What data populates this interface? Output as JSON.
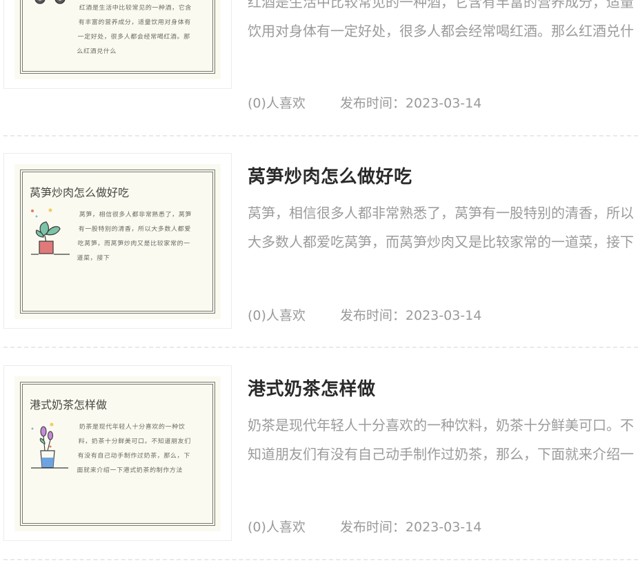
{
  "articles": [
    {
      "title": "",
      "thumb_title": "",
      "thumb_text": "红酒是生活中比较常见的一种酒，它含有丰富的营养成分，适量饮用对身体有一定好处，很多人都会经常喝红酒。那么红酒兑什么",
      "desc": "红酒是生活中比较常见的一种酒，它含有丰富的营养成分，适量饮用对身体有一定好处，很多人都会经常喝红酒。那么红酒兑什么",
      "likes": "(0)人喜欢",
      "time": "发布时间：2023-03-14",
      "icon": "jeep-icon"
    },
    {
      "title": "莴笋炒肉怎么做好吃",
      "thumb_title": "莴笋炒肉怎么做好吃",
      "thumb_text": "莴笋，相信很多人都非常熟悉了，莴笋有一股特别的清香，所以大多数人都爱吃莴笋，而莴笋炒肉又是比较家常的一道菜，接下",
      "desc": "莴笋，相信很多人都非常熟悉了，莴笋有一股特别的清香，所以大多数人都爱吃莴笋，而莴笋炒肉又是比较家常的一道菜，接下",
      "likes": "(0)人喜欢",
      "time": "发布时间：2023-03-14",
      "icon": "potted-plant-icon"
    },
    {
      "title": "港式奶茶怎样做",
      "thumb_title": "港式奶茶怎样做",
      "thumb_text": "奶茶是现代年轻人十分喜欢的一种饮料，奶茶十分鲜美可口。不知道朋友们有没有自己动手制作过奶茶，那么，下面就来介绍一下港式奶茶的制作方法",
      "desc": "奶茶是现代年轻人十分喜欢的一种饮料，奶茶十分鲜美可口。不知道朋友们有没有自己动手制作过奶茶，那么，下面就来介绍一下港式奶茶的制作方法",
      "likes": "(0)人喜欢",
      "time": "发布时间：2023-03-14",
      "icon": "flower-vase-icon"
    }
  ],
  "colors": {
    "title": "#2a2a2a",
    "text": "#9b9b9b",
    "thumb_paper": "#fbfaf1",
    "divider": "#e9e9e9"
  }
}
